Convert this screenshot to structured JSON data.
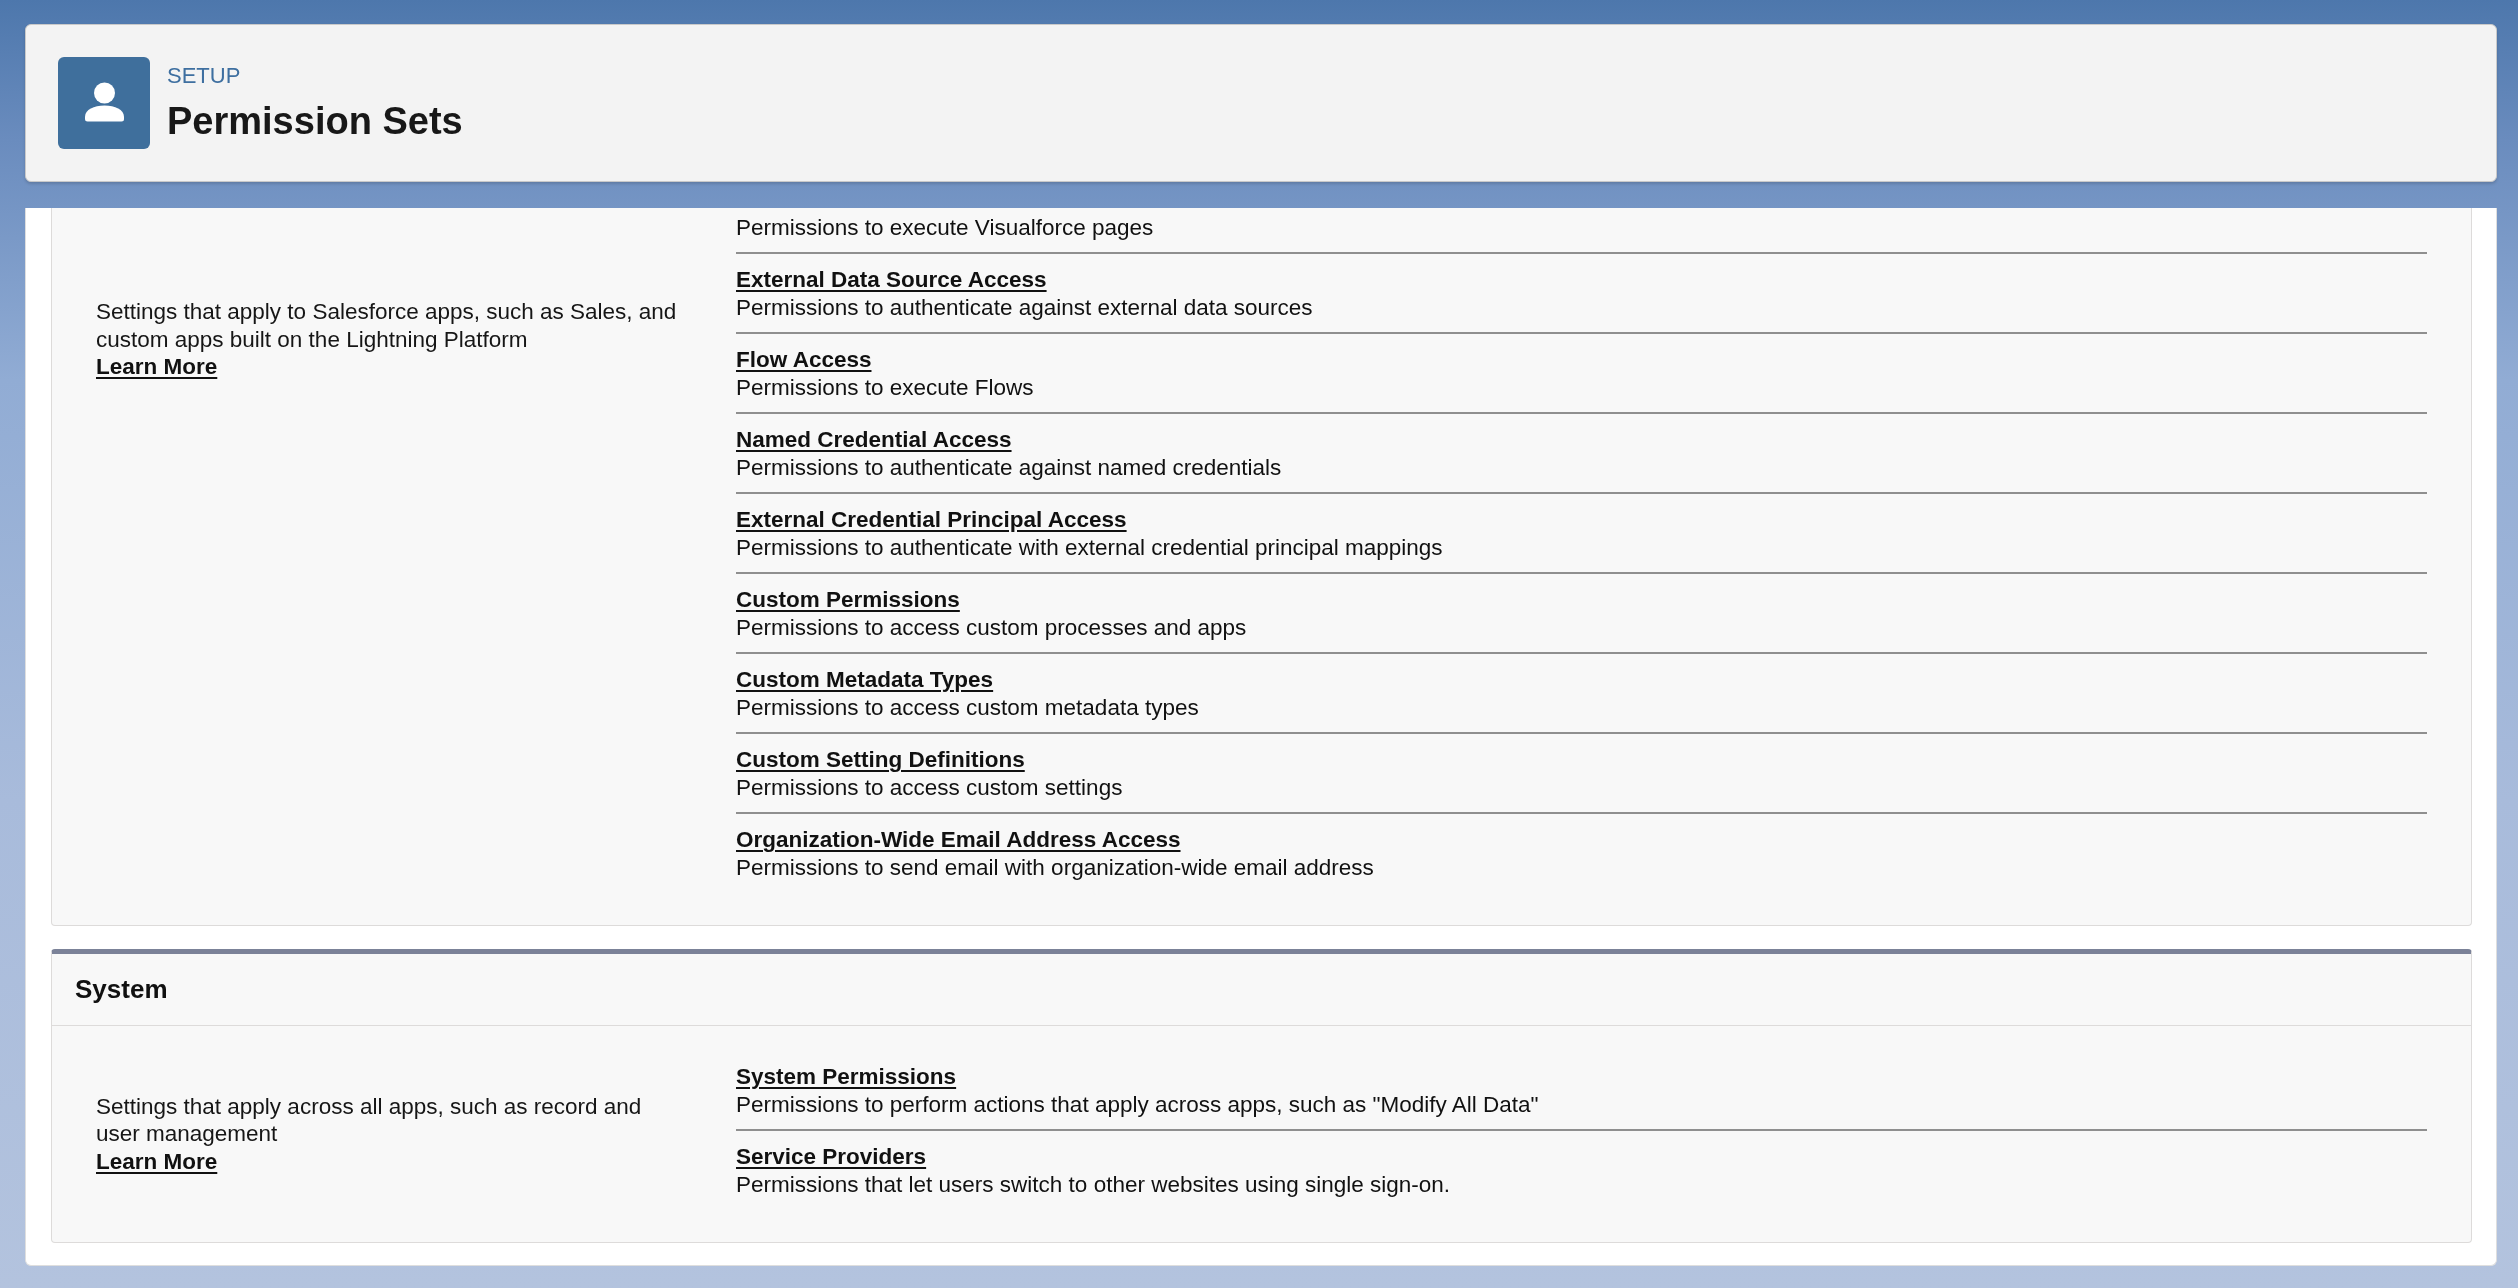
{
  "header": {
    "eyebrow": "SETUP",
    "title": "Permission Sets"
  },
  "sections": [
    {
      "description": "Settings that apply to Salesforce apps, such as Sales, and custom apps built on the Lightning Platform",
      "link": "Learn More",
      "items": [
        {
          "description": "Permissions to execute Visualforce pages"
        },
        {
          "title": "External Data Source Access",
          "description": "Permissions to authenticate against external data sources"
        },
        {
          "title": "Flow Access",
          "description": "Permissions to execute Flows"
        },
        {
          "title": "Named Credential Access",
          "description": "Permissions to authenticate against named credentials"
        },
        {
          "title": "External Credential Principal Access",
          "description": "Permissions to authenticate with external credential principal mappings"
        },
        {
          "title": "Custom Permissions",
          "description": "Permissions to access custom processes and apps"
        },
        {
          "title": "Custom Metadata Types",
          "description": "Permissions to access custom metadata types"
        },
        {
          "title": "Custom Setting Definitions",
          "description": "Permissions to access custom settings"
        },
        {
          "title": "Organization-Wide Email Address Access",
          "description": "Permissions to send email with organization-wide email address"
        }
      ]
    },
    {
      "title": "System",
      "description": "Settings that apply across all apps, such as record and user management",
      "link": "Learn More",
      "items": [
        {
          "title": "System Permissions",
          "description": "Permissions to perform actions that apply across apps, such as \"Modify All Data\""
        },
        {
          "title": "Service Providers",
          "description": "Permissions that let users switch to other websites using single sign-on."
        }
      ]
    }
  ]
}
